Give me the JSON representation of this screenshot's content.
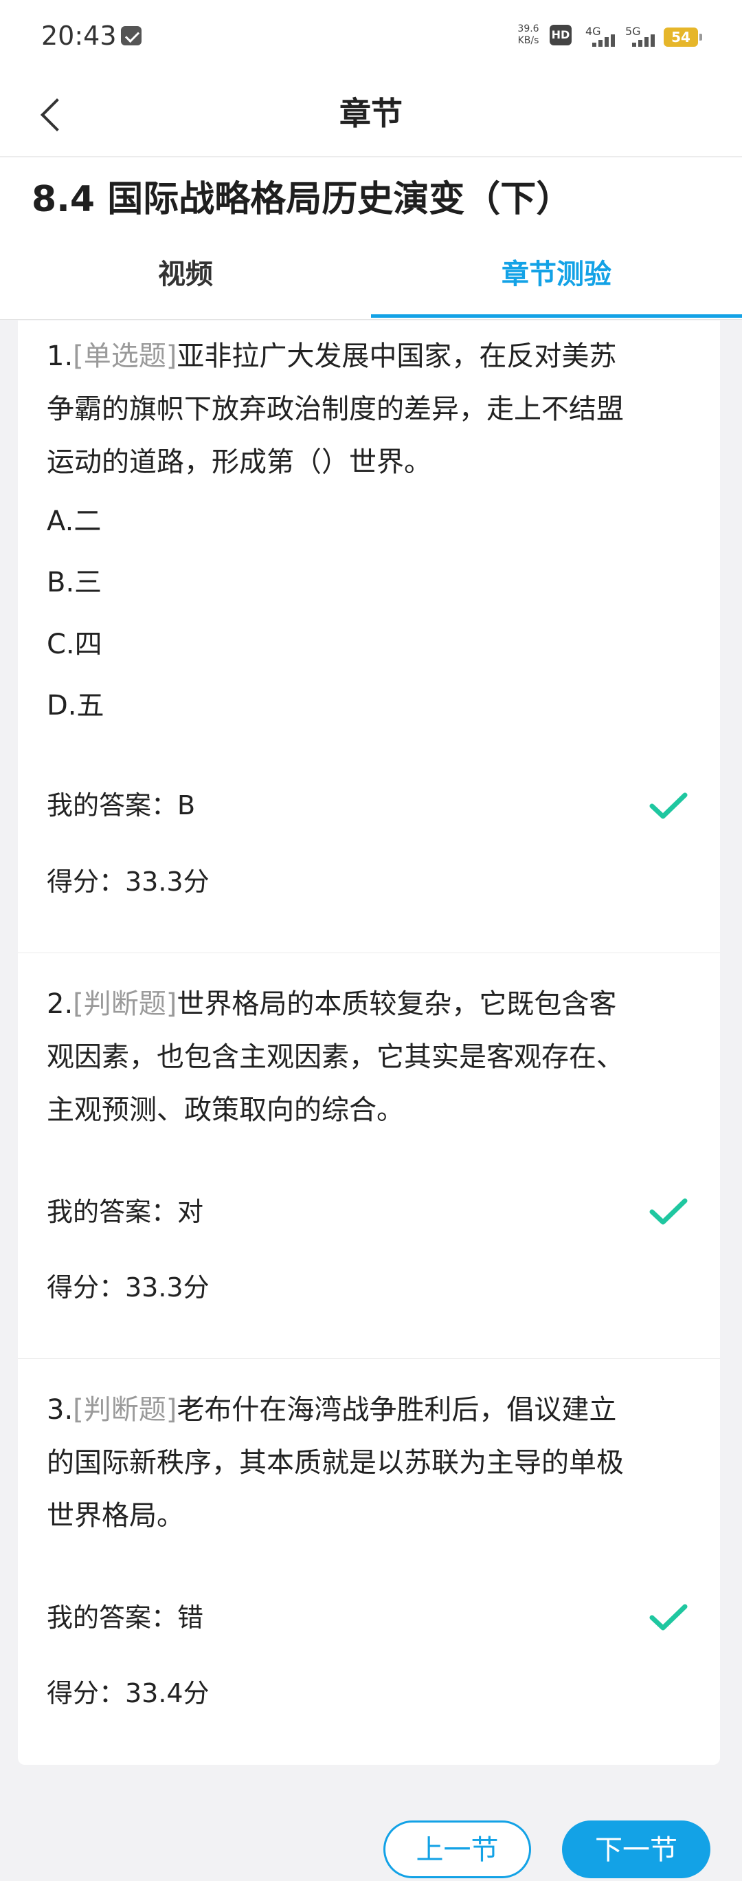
{
  "status_bar": {
    "time": "20:43",
    "net_speed_value": "39.6",
    "net_speed_unit": "KB/s",
    "hd_label": "HD",
    "signal_4g": "4G",
    "signal_5g": "5G",
    "battery": "54"
  },
  "nav": {
    "title": "章节"
  },
  "chapter": {
    "title": "8.4 国际战略格局历史演变（下）",
    "tabs": [
      {
        "label": "视频",
        "active": false
      },
      {
        "label": "章节测验",
        "active": true
      }
    ]
  },
  "questions": [
    {
      "number": "1.",
      "type": "[单选题]",
      "text_line1": "亚非拉广大发展中国家，在反对美苏",
      "text_line2": "争霸的旗帜下放弃政治制度的差异，走上不结盟",
      "text_line3": "运动的道路，形成第（）世界。",
      "options": [
        "A.二",
        "B.三",
        "C.四",
        "D.五"
      ],
      "answer": "我的答案：B",
      "score": "得分：33.3分",
      "correct": true
    },
    {
      "number": "2.",
      "type": "[判断题]",
      "text_line1": "世界格局的本质较复杂，它既包含客",
      "text_line2": "观因素，也包含主观因素，它其实是客观存在、",
      "text_line3": "主观预测、政策取向的综合。",
      "answer": "我的答案：对",
      "score": "得分：33.3分",
      "correct": true
    },
    {
      "number": "3.",
      "type": "[判断题]",
      "text_line1": "老布什在海湾战争胜利后，倡议建立",
      "text_line2": "的国际新秩序，其本质就是以苏联为主导的单极",
      "text_line3": "世界格局。",
      "answer": "我的答案：错",
      "score": "得分：33.4分",
      "correct": true
    }
  ],
  "buttons": {
    "prev": "上一节",
    "next": "下一节"
  },
  "colors": {
    "accent": "#13a2e6",
    "check": "#1fc7a0",
    "type_label": "#9a9a9a"
  }
}
